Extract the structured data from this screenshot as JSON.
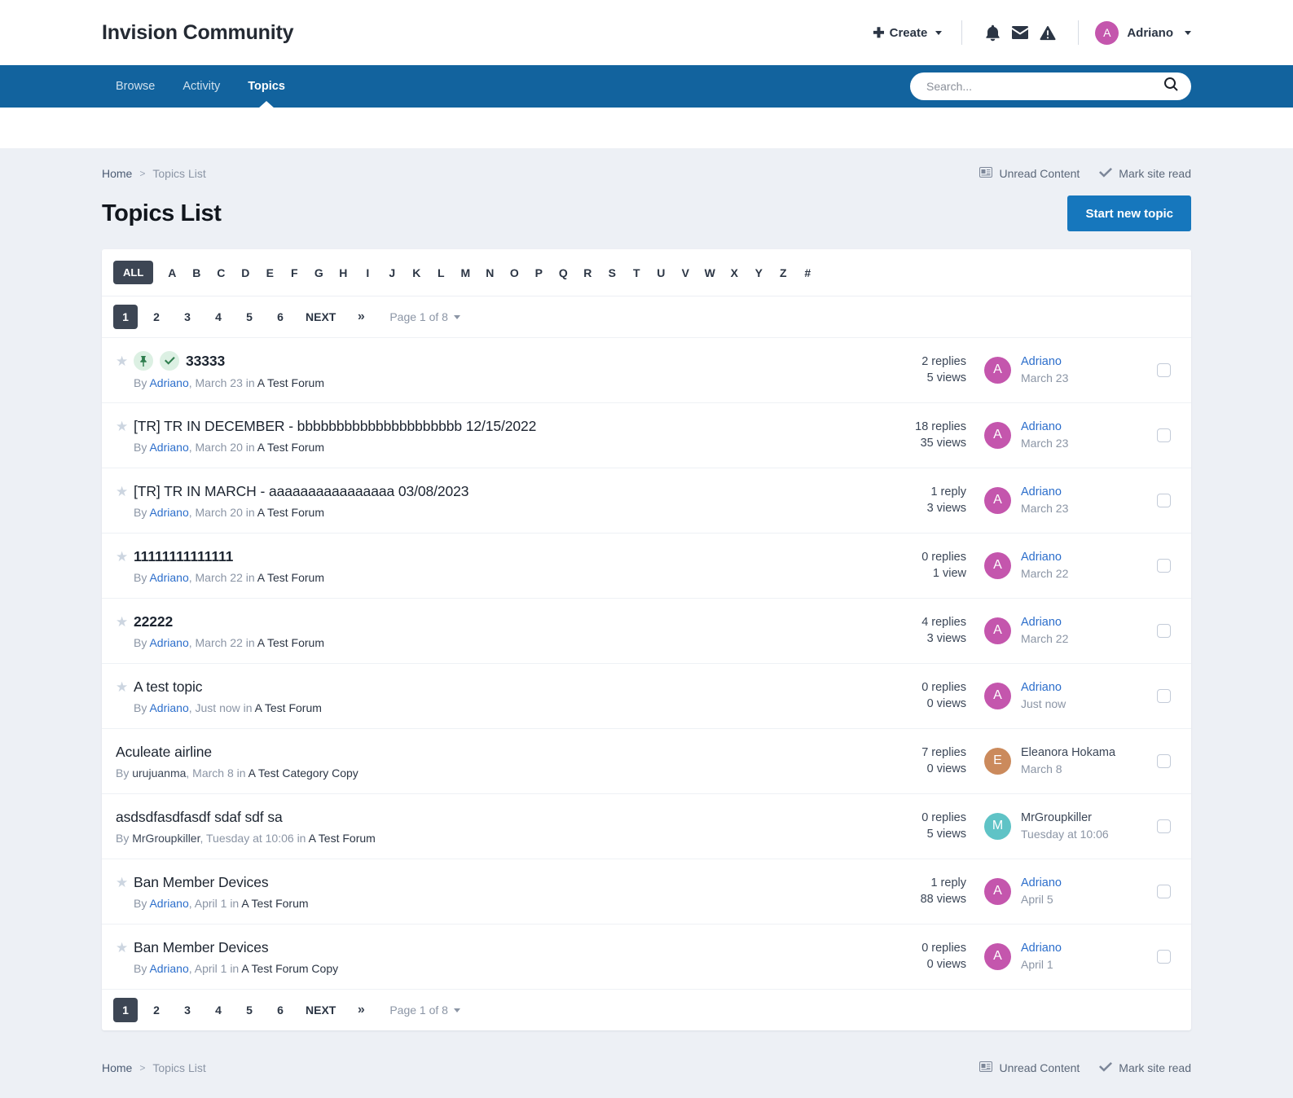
{
  "header": {
    "site_title": "Invision Community",
    "create_label": "Create",
    "icons": [
      "bell-icon",
      "envelope-icon",
      "warning-icon"
    ],
    "user_name": "Adriano",
    "user_initial": "A"
  },
  "nav": {
    "links": [
      {
        "label": "Browse",
        "active": false
      },
      {
        "label": "Activity",
        "active": false
      },
      {
        "label": "Topics",
        "active": true
      }
    ],
    "search_placeholder": "Search...",
    "search_value": ""
  },
  "breadcrumb": {
    "home": "Home",
    "separator": ">",
    "current": "Topics List"
  },
  "crumb_actions": {
    "unread": "Unread Content",
    "mark_read": "Mark site read"
  },
  "page": {
    "title": "Topics List",
    "start_topic_button": "Start new topic"
  },
  "alpha_filter": {
    "all_label": "ALL",
    "letters": [
      "A",
      "B",
      "C",
      "D",
      "E",
      "F",
      "G",
      "H",
      "I",
      "J",
      "K",
      "L",
      "M",
      "N",
      "O",
      "P",
      "Q",
      "R",
      "S",
      "T",
      "U",
      "V",
      "W",
      "X",
      "Y",
      "Z",
      "#"
    ]
  },
  "pagination": {
    "pages": [
      "1",
      "2",
      "3",
      "4",
      "5",
      "6"
    ],
    "active_page": "1",
    "next_label": "NEXT",
    "last_label": "»",
    "page_info": "Page 1 of 8"
  },
  "topics": [
    {
      "title": "33333",
      "bold": true,
      "starred": true,
      "pinned": true,
      "answered": true,
      "by": "By",
      "author": "Adriano",
      "author_link": true,
      "date": "March 23",
      "in": "in",
      "forum": "A Test Forum",
      "replies": "2 replies",
      "views": "5 views",
      "last_user": "Adriano",
      "last_user_link": true,
      "last_initial": "A",
      "last_color": "#c456ad",
      "last_date": "March 23"
    },
    {
      "title": "[TR] TR IN DECEMBER - bbbbbbbbbbbbbbbbbbbbb 12/15/2022",
      "bold": false,
      "starred": true,
      "pinned": false,
      "answered": false,
      "by": "By",
      "author": "Adriano",
      "author_link": true,
      "date": "March 20",
      "in": "in",
      "forum": "A Test Forum",
      "replies": "18 replies",
      "views": "35 views",
      "last_user": "Adriano",
      "last_user_link": true,
      "last_initial": "A",
      "last_color": "#c456ad",
      "last_date": "March 23"
    },
    {
      "title": "[TR] TR IN MARCH - aaaaaaaaaaaaaaaa 03/08/2023",
      "bold": false,
      "starred": true,
      "pinned": false,
      "answered": false,
      "by": "By",
      "author": "Adriano",
      "author_link": true,
      "date": "March 20",
      "in": "in",
      "forum": "A Test Forum",
      "replies": "1 reply",
      "views": "3 views",
      "last_user": "Adriano",
      "last_user_link": true,
      "last_initial": "A",
      "last_color": "#c456ad",
      "last_date": "March 23"
    },
    {
      "title": "11111111111111",
      "bold": true,
      "starred": true,
      "pinned": false,
      "answered": false,
      "by": "By",
      "author": "Adriano",
      "author_link": true,
      "date": "March 22",
      "in": "in",
      "forum": "A Test Forum",
      "replies": "0 replies",
      "views": "1 view",
      "last_user": "Adriano",
      "last_user_link": true,
      "last_initial": "A",
      "last_color": "#c456ad",
      "last_date": "March 22"
    },
    {
      "title": "22222",
      "bold": true,
      "starred": true,
      "pinned": false,
      "answered": false,
      "by": "By",
      "author": "Adriano",
      "author_link": true,
      "date": "March 22",
      "in": "in",
      "forum": "A Test Forum",
      "replies": "4 replies",
      "views": "3 views",
      "last_user": "Adriano",
      "last_user_link": true,
      "last_initial": "A",
      "last_color": "#c456ad",
      "last_date": "March 22"
    },
    {
      "title": "A test topic",
      "bold": false,
      "starred": true,
      "pinned": false,
      "answered": false,
      "by": "By",
      "author": "Adriano",
      "author_link": true,
      "date": "Just now",
      "in": "in",
      "forum": "A Test Forum",
      "replies": "0 replies",
      "views": "0 views",
      "last_user": "Adriano",
      "last_user_link": true,
      "last_initial": "A",
      "last_color": "#c456ad",
      "last_date": "Just now"
    },
    {
      "title": "Aculeate airline",
      "bold": false,
      "starred": false,
      "pinned": false,
      "answered": false,
      "by": "By",
      "author": "urujuanma",
      "author_link": false,
      "date": "March 8",
      "in": "in",
      "forum": "A Test Category Copy",
      "replies": "7 replies",
      "views": "0 views",
      "last_user": "Eleanora Hokama",
      "last_user_link": false,
      "last_initial": "E",
      "last_color": "#cb8a5c",
      "last_date": "March 8"
    },
    {
      "title": "asdsdfasdfasdf sdaf sdf sa",
      "bold": false,
      "starred": false,
      "pinned": false,
      "answered": false,
      "by": "By",
      "author": "MrGroupkiller",
      "author_link": false,
      "date": "Tuesday at 10:06",
      "in": "in",
      "forum": "A Test Forum",
      "replies": "0 replies",
      "views": "5 views",
      "last_user": "MrGroupkiller",
      "last_user_link": false,
      "last_initial": "M",
      "last_color": "#5fc3c6",
      "last_date": "Tuesday at 10:06"
    },
    {
      "title": "Ban Member Devices",
      "bold": false,
      "starred": true,
      "pinned": false,
      "answered": false,
      "by": "By",
      "author": "Adriano",
      "author_link": true,
      "date": "April 1",
      "in": "in",
      "forum": "A Test Forum",
      "replies": "1 reply",
      "views": "88 views",
      "last_user": "Adriano",
      "last_user_link": true,
      "last_initial": "A",
      "last_color": "#c456ad",
      "last_date": "April 5"
    },
    {
      "title": "Ban Member Devices",
      "bold": false,
      "starred": true,
      "pinned": false,
      "answered": false,
      "by": "By",
      "author": "Adriano",
      "author_link": true,
      "date": "April 1",
      "in": "in",
      "forum": "A Test Forum Copy",
      "replies": "0 replies",
      "views": "0 views",
      "last_user": "Adriano",
      "last_user_link": true,
      "last_initial": "A",
      "last_color": "#c456ad",
      "last_date": "April 1"
    }
  ],
  "colors": {
    "nav_blue": "#12639e",
    "button_blue": "#1677bd",
    "link_blue": "#2c6ecb",
    "dark_chip": "#3d4654",
    "page_bg": "#edf0f5"
  }
}
